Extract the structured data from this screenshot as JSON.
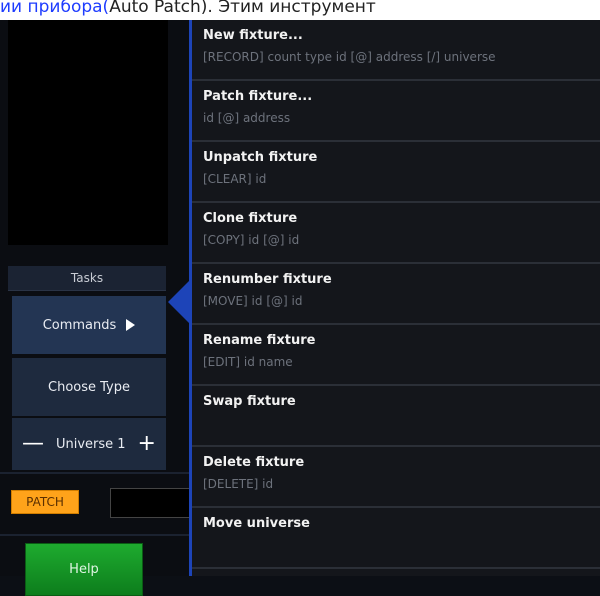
{
  "page_strip": {
    "link_text": "ии прибора(",
    "plain_text": "Auto Patch). Этим инструмент"
  },
  "tasks": {
    "header": "Tasks",
    "commands_label": "Commands",
    "choose_type_label": "Choose Type",
    "universe": {
      "minus": "—",
      "label": "Universe 1",
      "plus": "+"
    }
  },
  "patch_label": "PATCH",
  "help_label": "Help",
  "menu": {
    "items": [
      {
        "title": "New fixture...",
        "syntax": "[RECORD] count type id [@] address [/] universe"
      },
      {
        "title": "Patch fixture...",
        "syntax": "id [@] address"
      },
      {
        "title": "Unpatch fixture",
        "syntax": "[CLEAR] id"
      },
      {
        "title": "Clone fixture",
        "syntax": "[COPY] id [@] id"
      },
      {
        "title": "Renumber fixture",
        "syntax": "[MOVE] id [@] id"
      },
      {
        "title": "Rename fixture",
        "syntax": "[EDIT] id name"
      },
      {
        "title": "Swap fixture",
        "syntax": ""
      },
      {
        "title": "Delete fixture",
        "syntax": "[DELETE] id"
      },
      {
        "title": "Move universe",
        "syntax": ""
      }
    ]
  },
  "colors": {
    "accent_blue": "#1d44b8",
    "patch_orange": "#ffa31a",
    "help_green": "#1eab2f",
    "menu_bg": "#14161b"
  }
}
